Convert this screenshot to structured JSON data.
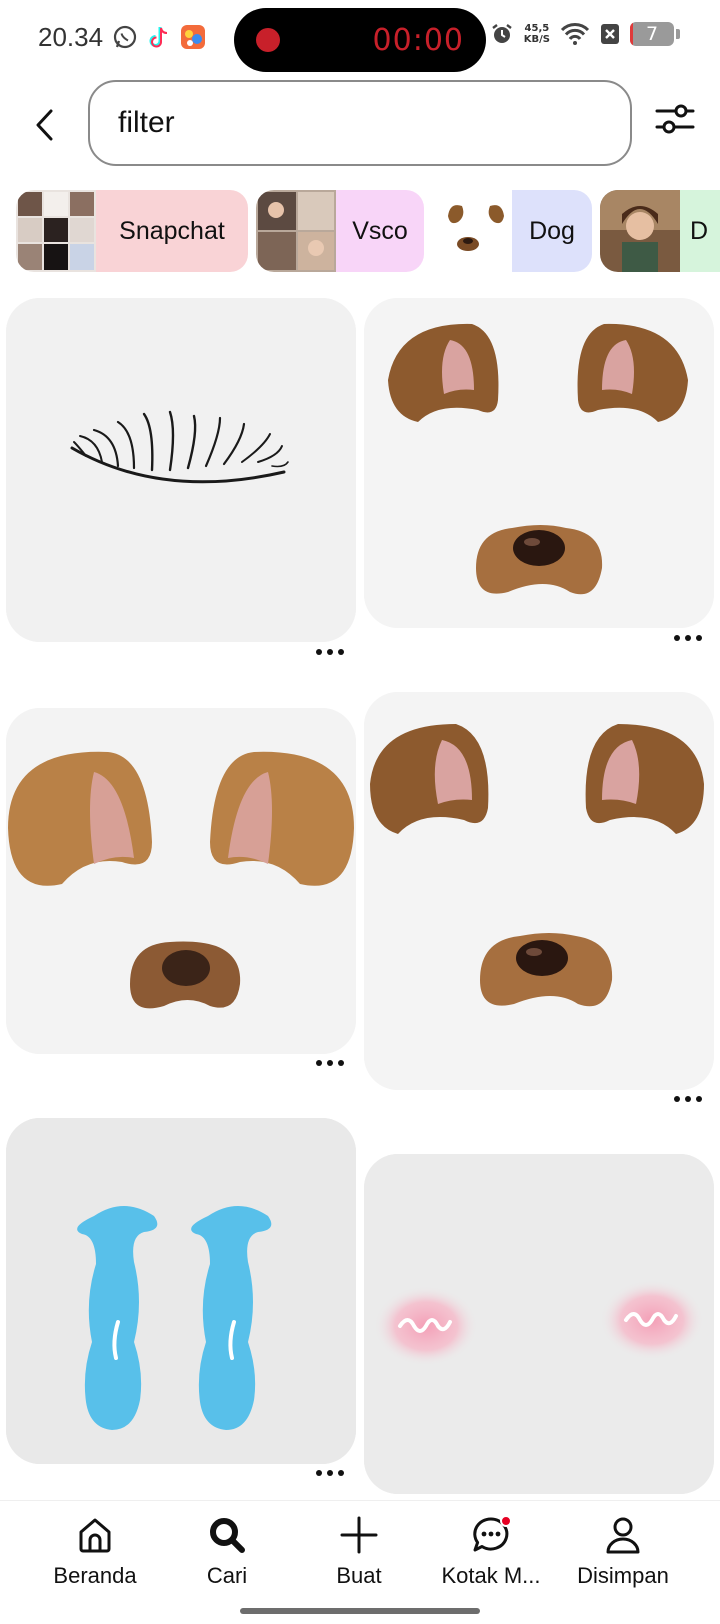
{
  "status_bar": {
    "time": "20.34",
    "recording_timer": "00:00",
    "net_speed_value": "45,5",
    "net_speed_unit": "KB/S",
    "battery_level": "7",
    "battery_fraction": 0.07,
    "icons": [
      "whatsapp-icon",
      "tiktok-icon",
      "game-app-icon",
      "alarm-icon",
      "wifi-icon",
      "sim-off-icon",
      "battery-icon"
    ],
    "recording_color": "#c8202a"
  },
  "search": {
    "query": "filter",
    "back_icon": "chevron-left-icon",
    "filter_icon": "sliders-icon"
  },
  "chips": [
    {
      "label": "Snapchat",
      "color": "#f9d3d6"
    },
    {
      "label": "Vsco",
      "color": "#f8d5f8"
    },
    {
      "label": "Dog",
      "color": "#dde1fb"
    },
    {
      "label": "D",
      "color": "#d6f4dc"
    }
  ],
  "pins": [
    {
      "subject": "eyelashes"
    },
    {
      "subject": "dog ears and nose"
    },
    {
      "subject": "dog ears and nose"
    },
    {
      "subject": "dog ears and nose"
    },
    {
      "subject": "tears"
    },
    {
      "subject": "blush cheeks"
    }
  ],
  "nav": {
    "items": [
      {
        "label": "Beranda",
        "icon": "home-icon"
      },
      {
        "label": "Cari",
        "icon": "search-icon"
      },
      {
        "label": "Buat",
        "icon": "plus-icon"
      },
      {
        "label": "Kotak M...",
        "icon": "chat-icon"
      },
      {
        "label": "Disimpan",
        "icon": "profile-icon"
      }
    ],
    "active": "Cari",
    "notification_color": "#e60023"
  }
}
